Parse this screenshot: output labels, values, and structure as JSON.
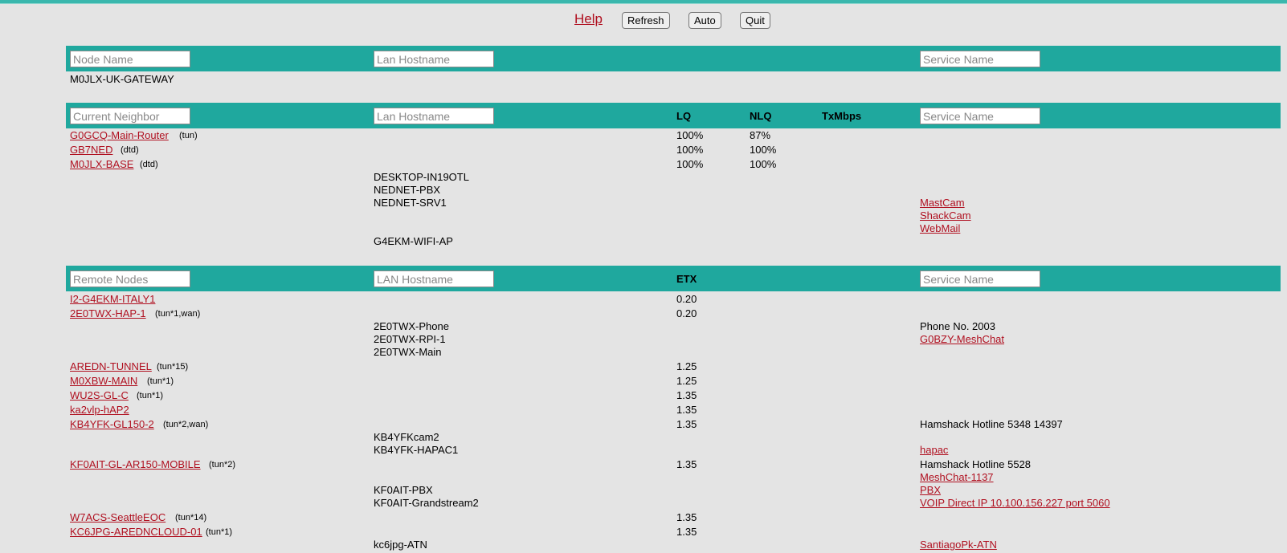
{
  "toolbar": {
    "help": "Help",
    "refresh": "Refresh",
    "auto": "Auto",
    "quit": "Quit"
  },
  "node_section": {
    "node_name_placeholder": "Node Name",
    "lan_hostname_placeholder": "Lan Hostname",
    "service_name_placeholder": "Service Name",
    "node_name": "M0JLX-UK-GATEWAY"
  },
  "neighbor_section": {
    "neighbor_placeholder": "Current Neighbor",
    "lan_hostname_placeholder": "Lan Hostname",
    "service_name_placeholder": "Service Name",
    "col_lq": "LQ",
    "col_nlq": "NLQ",
    "col_txmbps": "TxMbps",
    "rows": [
      {
        "name": "G0GCQ-Main-Router",
        "tag": "(tun)",
        "lq": "100%",
        "nlq": "87%"
      },
      {
        "name": "GB7NED",
        "tag": "(dtd)",
        "lq": "100%",
        "nlq": "100%"
      },
      {
        "name": "M0JLX-BASE",
        "tag": "(dtd)",
        "lq": "100%",
        "nlq": "100%"
      }
    ],
    "hosts": [
      "DESKTOP-IN19OTL",
      "NEDNET-PBX",
      "NEDNET-SRV1",
      "G4EKM-WIFI-AP"
    ],
    "services": [
      "MastCam",
      "ShackCam",
      "WebMail"
    ]
  },
  "remote_section": {
    "remote_placeholder": "Remote Nodes",
    "lan_hostname_placeholder": "LAN Hostname",
    "service_name_placeholder": "Service Name",
    "col_etx": "ETX",
    "rows": [
      {
        "name": "I2-G4EKM-ITALY1",
        "tag": "",
        "etx": "0.20"
      },
      {
        "name": "2E0TWX-HAP-1",
        "tag": "(tun*1,wan)",
        "etx": "0.20"
      },
      {
        "name": "AREDN-TUNNEL",
        "tag": "(tun*15)",
        "etx": "1.25"
      },
      {
        "name": "M0XBW-MAIN",
        "tag": "(tun*1)",
        "etx": "1.25"
      },
      {
        "name": "WU2S-GL-C",
        "tag": "(tun*1)",
        "etx": "1.35"
      },
      {
        "name": "ka2vlp-hAP2",
        "tag": "",
        "etx": "1.35"
      },
      {
        "name": "KB4YFK-GL150-2",
        "tag": "(tun*2,wan)",
        "etx": "1.35"
      },
      {
        "name": "KF0AIT-GL-AR150-MOBILE",
        "tag": "(tun*2)",
        "etx": "1.35"
      },
      {
        "name": "W7ACS-SeattleEOC",
        "tag": "(tun*14)",
        "etx": "1.35"
      },
      {
        "name": "KC6JPG-AREDNCLOUD-01",
        "tag": "(tun*1)",
        "etx": "1.35"
      }
    ],
    "hosts": [
      "2E0TWX-Phone",
      "2E0TWX-RPI-1",
      "2E0TWX-Main",
      "KB4YFKcam2",
      "KB4YFK-HAPAC1",
      "KF0AIT-PBX",
      "KF0AIT-Grandstream2",
      "kc6jpg-ATN"
    ],
    "services_text": [
      "Phone No. 2003",
      "Hamshack Hotline 5348 14397",
      "Hamshack Hotline 5528"
    ],
    "services_link": [
      "G0BZY-MeshChat",
      "hapac",
      "MeshChat-1137",
      "PBX",
      "VOIP Direct IP 10.100.156.227 port 5060",
      "SantiagoPk-ATN"
    ]
  }
}
